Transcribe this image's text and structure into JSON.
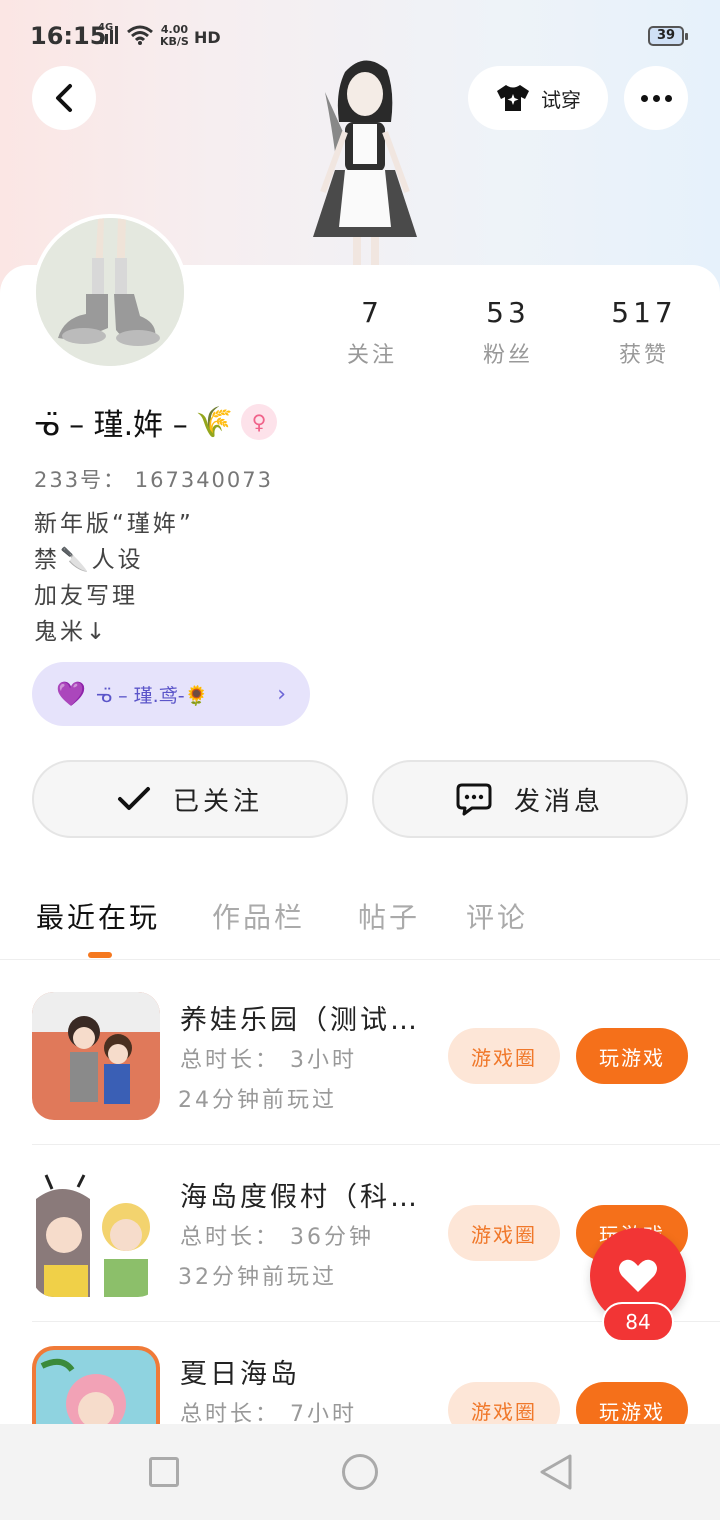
{
  "status_bar": {
    "time": "16:15",
    "network": "4G",
    "speed": "4.00",
    "speed_unit": "KB/S",
    "hd": "HD",
    "battery": "39"
  },
  "header": {
    "tryon_label": "试穿",
    "back_icon": "chevron-left-icon",
    "more_icon": "more-dots-icon",
    "tryon_icon": "tshirt-icon"
  },
  "profile": {
    "name": "ᓀ̈ – 瑾.姩 –",
    "name_emoji": "🌾",
    "gender_symbol": "♀",
    "uid": "233号： 167340073",
    "bio": [
      "新年版“瑾姩”",
      "禁🔪人设",
      "加友写理",
      "鬼米↓"
    ],
    "stats": [
      {
        "value": "7",
        "label": "关注"
      },
      {
        "value": "53",
        "label": "粉丝"
      },
      {
        "value": "517",
        "label": "获赞"
      }
    ]
  },
  "relation": {
    "heart_icon": "💜",
    "label": "ᓀ̈ – 瑾.鸢-🌻",
    "chevron": "›"
  },
  "actions": {
    "follow_label": "已关注",
    "message_label": "发消息"
  },
  "tabs": [
    {
      "label": "最近在玩",
      "active": true
    },
    {
      "label": "作品栏",
      "active": false
    },
    {
      "label": "帖子",
      "active": false
    },
    {
      "label": "评论",
      "active": false
    }
  ],
  "games": [
    {
      "name": "养娃乐园（测试…",
      "duration": "总时长： 3小时",
      "last_played": "24分钟前玩过",
      "circle_label": "游戏圈",
      "play_label": "玩游戏"
    },
    {
      "name": "海岛度假村（科…",
      "duration": "总时长： 36分钟",
      "last_played": "32分钟前玩过",
      "circle_label": "游戏圈",
      "play_label": "玩游戏"
    },
    {
      "name": "夏日海岛",
      "duration": "总时长： 7小时",
      "last_played": "",
      "circle_label": "游戏圈",
      "play_label": "玩游戏"
    }
  ],
  "like_fab": {
    "count": "84"
  },
  "colors": {
    "accent": "#f5701a",
    "like": "#f23535",
    "relation_bg": "#e6e3fb"
  }
}
